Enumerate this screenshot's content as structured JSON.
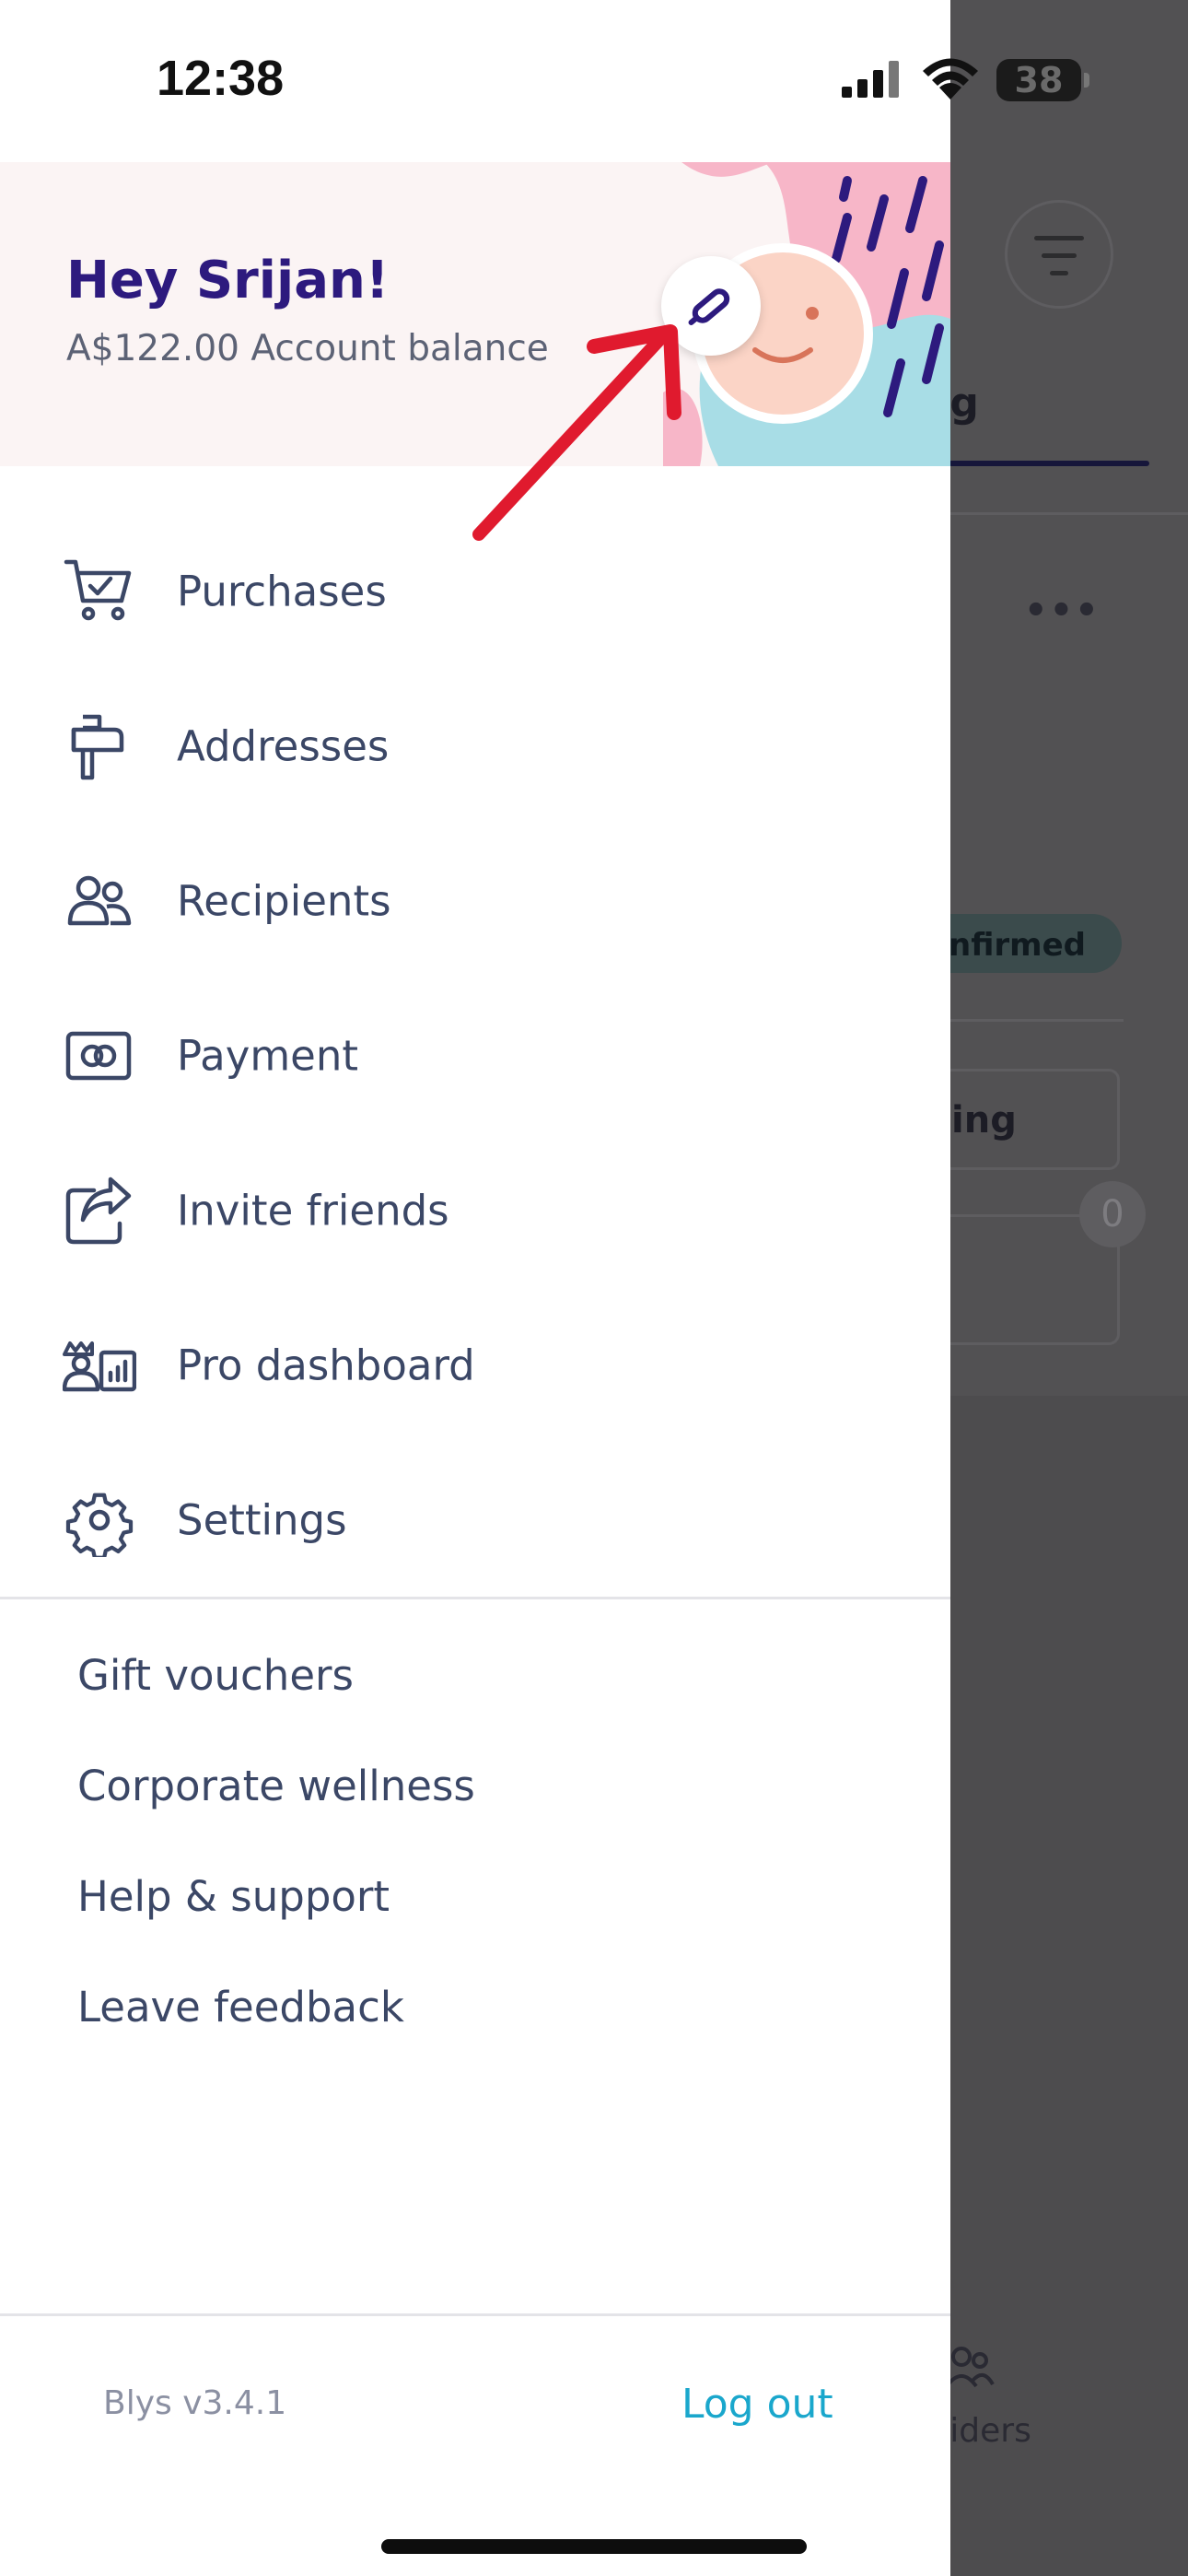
{
  "status_bar": {
    "time": "12:38",
    "battery": "38",
    "icons": [
      "signal-icon",
      "wifi-icon",
      "battery-icon"
    ]
  },
  "profile": {
    "greeting": "Hey Srijan!",
    "balance": "A$122.00 Account balance",
    "edit_icon": "pencil-icon"
  },
  "menu": {
    "items": [
      {
        "label": "Purchases",
        "icon": "cart-icon"
      },
      {
        "label": "Addresses",
        "icon": "mailbox-icon"
      },
      {
        "label": "Recipients",
        "icon": "people-icon"
      },
      {
        "label": "Payment",
        "icon": "card-icon"
      },
      {
        "label": "Invite friends",
        "icon": "share-icon"
      },
      {
        "label": "Pro dashboard",
        "icon": "pro-dashboard-icon"
      },
      {
        "label": "Settings",
        "icon": "gear-icon"
      }
    ]
  },
  "links": [
    {
      "label": "Gift vouchers"
    },
    {
      "label": "Corporate wellness"
    },
    {
      "label": "Help & support"
    },
    {
      "label": "Leave feedback"
    }
  ],
  "footer": {
    "version": "Blys v3.4.1",
    "logout": "Log out"
  },
  "background_screen": {
    "tab_fragment": "ng",
    "badge_fragment": "nfirmed",
    "box_fragment": "ing",
    "count": "0",
    "nav_fragment": "viders"
  },
  "colors": {
    "brand_purple": "#2d1a7e",
    "text": "#3b4766",
    "link_accent": "#1aa7cc",
    "header_bg": "#fbf4f4",
    "annotation_red": "#e01a2e"
  }
}
